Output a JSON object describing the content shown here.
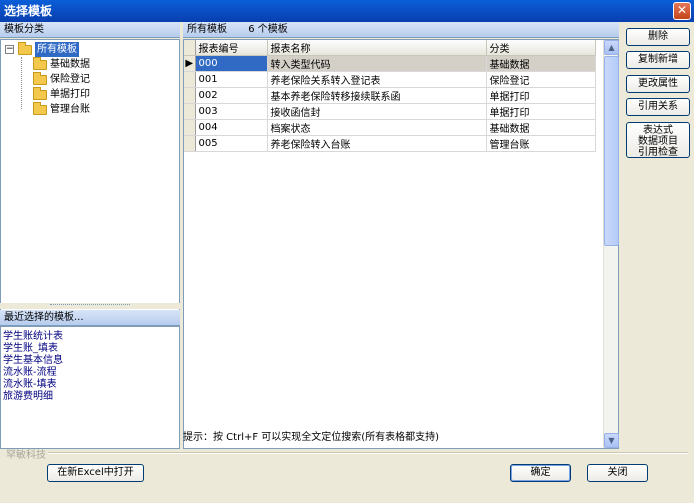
{
  "window": {
    "title": "选择模板",
    "close_label": "✕"
  },
  "left": {
    "tree_header": "模板分类",
    "tree": {
      "root": {
        "toggle": "−",
        "label": "所有模板"
      },
      "children": [
        "基础数据",
        "保险登记",
        "单据打印",
        "管理台账"
      ]
    },
    "recent_header": "最近选择的模板...",
    "recent_items": [
      "学生账统计表",
      "学生账_填表",
      "学生基本信息",
      "流水账-流程",
      "流水账-填表",
      "旅游费明细"
    ]
  },
  "right": {
    "header_title": "所有模板",
    "header_count": "6 个模板",
    "columns": [
      "报表编号",
      "报表名称",
      "分类"
    ],
    "row_indicator": "▶",
    "rows": [
      [
        "000",
        "转入类型代码",
        "基础数据"
      ],
      [
        "001",
        "养老保险关系转入登记表",
        "保险登记"
      ],
      [
        "002",
        "基本养老保险转移接续联系函",
        "单据打印"
      ],
      [
        "003",
        "接收函信封",
        "单据打印"
      ],
      [
        "004",
        "档案状态",
        "基础数据"
      ],
      [
        "005",
        "养老保险转入台账",
        "管理台账"
      ]
    ],
    "scroll_up": "▲",
    "scroll_down": "▼"
  },
  "side_buttons": {
    "delete": "删除",
    "copy_new": "复制新增",
    "change_props": "更改属性",
    "references": "引用关系",
    "expr_check_1": "表达式",
    "expr_check_2": "数据项目",
    "expr_check_3": "引用检查"
  },
  "hint": "提示：按 Ctrl+F 可以实现全文定位搜索(所有表格都支持)",
  "company": "罕敏科技",
  "bottom": {
    "open_excel": "在新Excel中打开",
    "ok": "确定",
    "close": "关闭"
  }
}
